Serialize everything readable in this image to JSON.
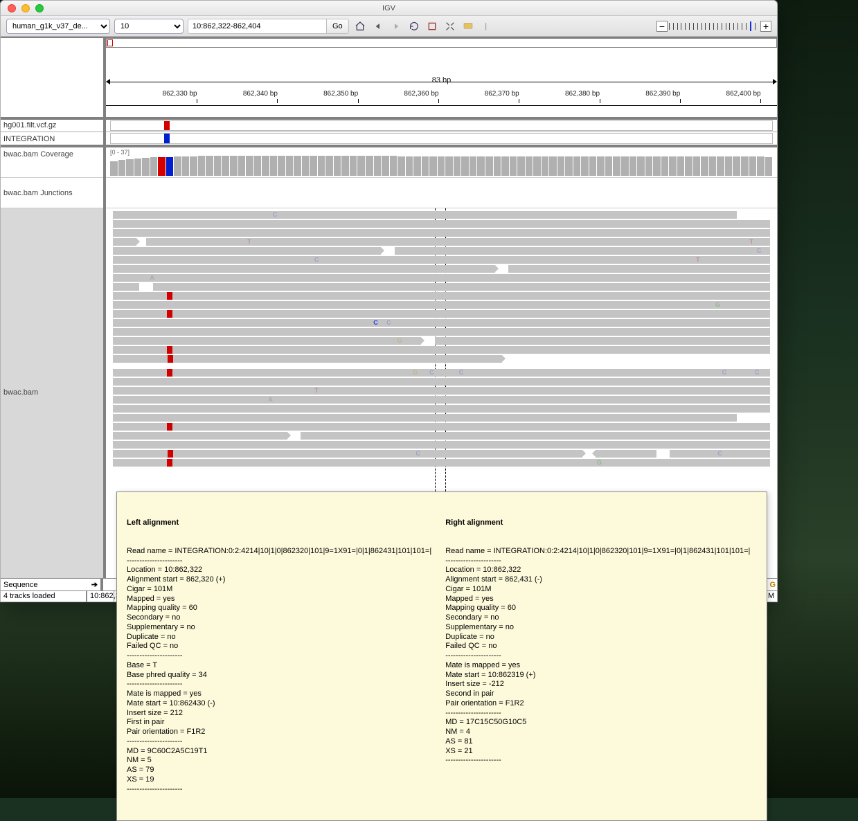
{
  "window": {
    "title": "IGV"
  },
  "toolbar": {
    "genome_option": "human_g1k_v37_de...",
    "chrom_option": "10",
    "locus": "10:862,322-862,404",
    "go": "Go"
  },
  "overview": {
    "span_label": "83 bp",
    "ticks": [
      "862,330 bp",
      "862,340 bp",
      "862,350 bp",
      "862,360 bp",
      "862,370 bp",
      "862,380 bp",
      "862,390 bp",
      "862,400 bp"
    ]
  },
  "tracks": {
    "vcf": "hg001.filt.vcf.gz",
    "integration": "INTEGRATION",
    "coverage": "bwac.bam Coverage",
    "junctions": "bwac.bam Junctions",
    "alignment": "bwac.bam",
    "cov_range": "[0 - 37]"
  },
  "footer": {
    "sequence": "Sequence",
    "tracks_loaded": "4 tracks loaded",
    "pos_label": "10:862,3",
    "right_cell": "M",
    "seq_tail": "G G"
  },
  "tooltip": {
    "left_title": "Left alignment",
    "right_title": "Right alignment",
    "left_lines": [
      "Read name = INTEGRATION:0:2:4214|10|1|0|862320|101|9=1X91=|0|1|862431|101|101=|",
      "----------------------",
      "Location = 10:862,322",
      "Alignment start = 862,320 (+)",
      "Cigar = 101M",
      "Mapped = yes",
      "Mapping quality = 60",
      "Secondary = no",
      "Supplementary = no",
      "Duplicate = no",
      "Failed QC = no",
      "----------------------",
      "Base = T",
      "Base phred quality = 34",
      "----------------------",
      "Mate is mapped = yes",
      "Mate start = 10:862430 (-)",
      "Insert size = 212",
      "First in pair",
      "Pair orientation = F1R2",
      "----------------------",
      "MD = 9C60C2A5C19T1",
      "NM = 5",
      "AS = 79",
      "XS = 19",
      "----------------------"
    ],
    "right_lines": [
      "Read name = INTEGRATION:0:2:4214|10|1|0|862320|101|9=1X91=|0|1|862431|101|101=|",
      "----------------------",
      "Location = 10:862,322",
      "Alignment start = 862,431 (-)",
      "Cigar = 101M",
      "Mapped = yes",
      "Mapping quality = 60",
      "Secondary = no",
      "Supplementary = no",
      "Duplicate = no",
      "Failed QC = no",
      "----------------------",
      "Mate is mapped = yes",
      "Mate start = 10:862319 (+)",
      "Insert size = -212",
      "Second in pair",
      "Pair orientation = F1R2",
      "----------------------",
      "MD = 17C15C50G10C5",
      "NM = 4",
      "AS = 81",
      "XS = 21",
      "----------------------"
    ]
  }
}
